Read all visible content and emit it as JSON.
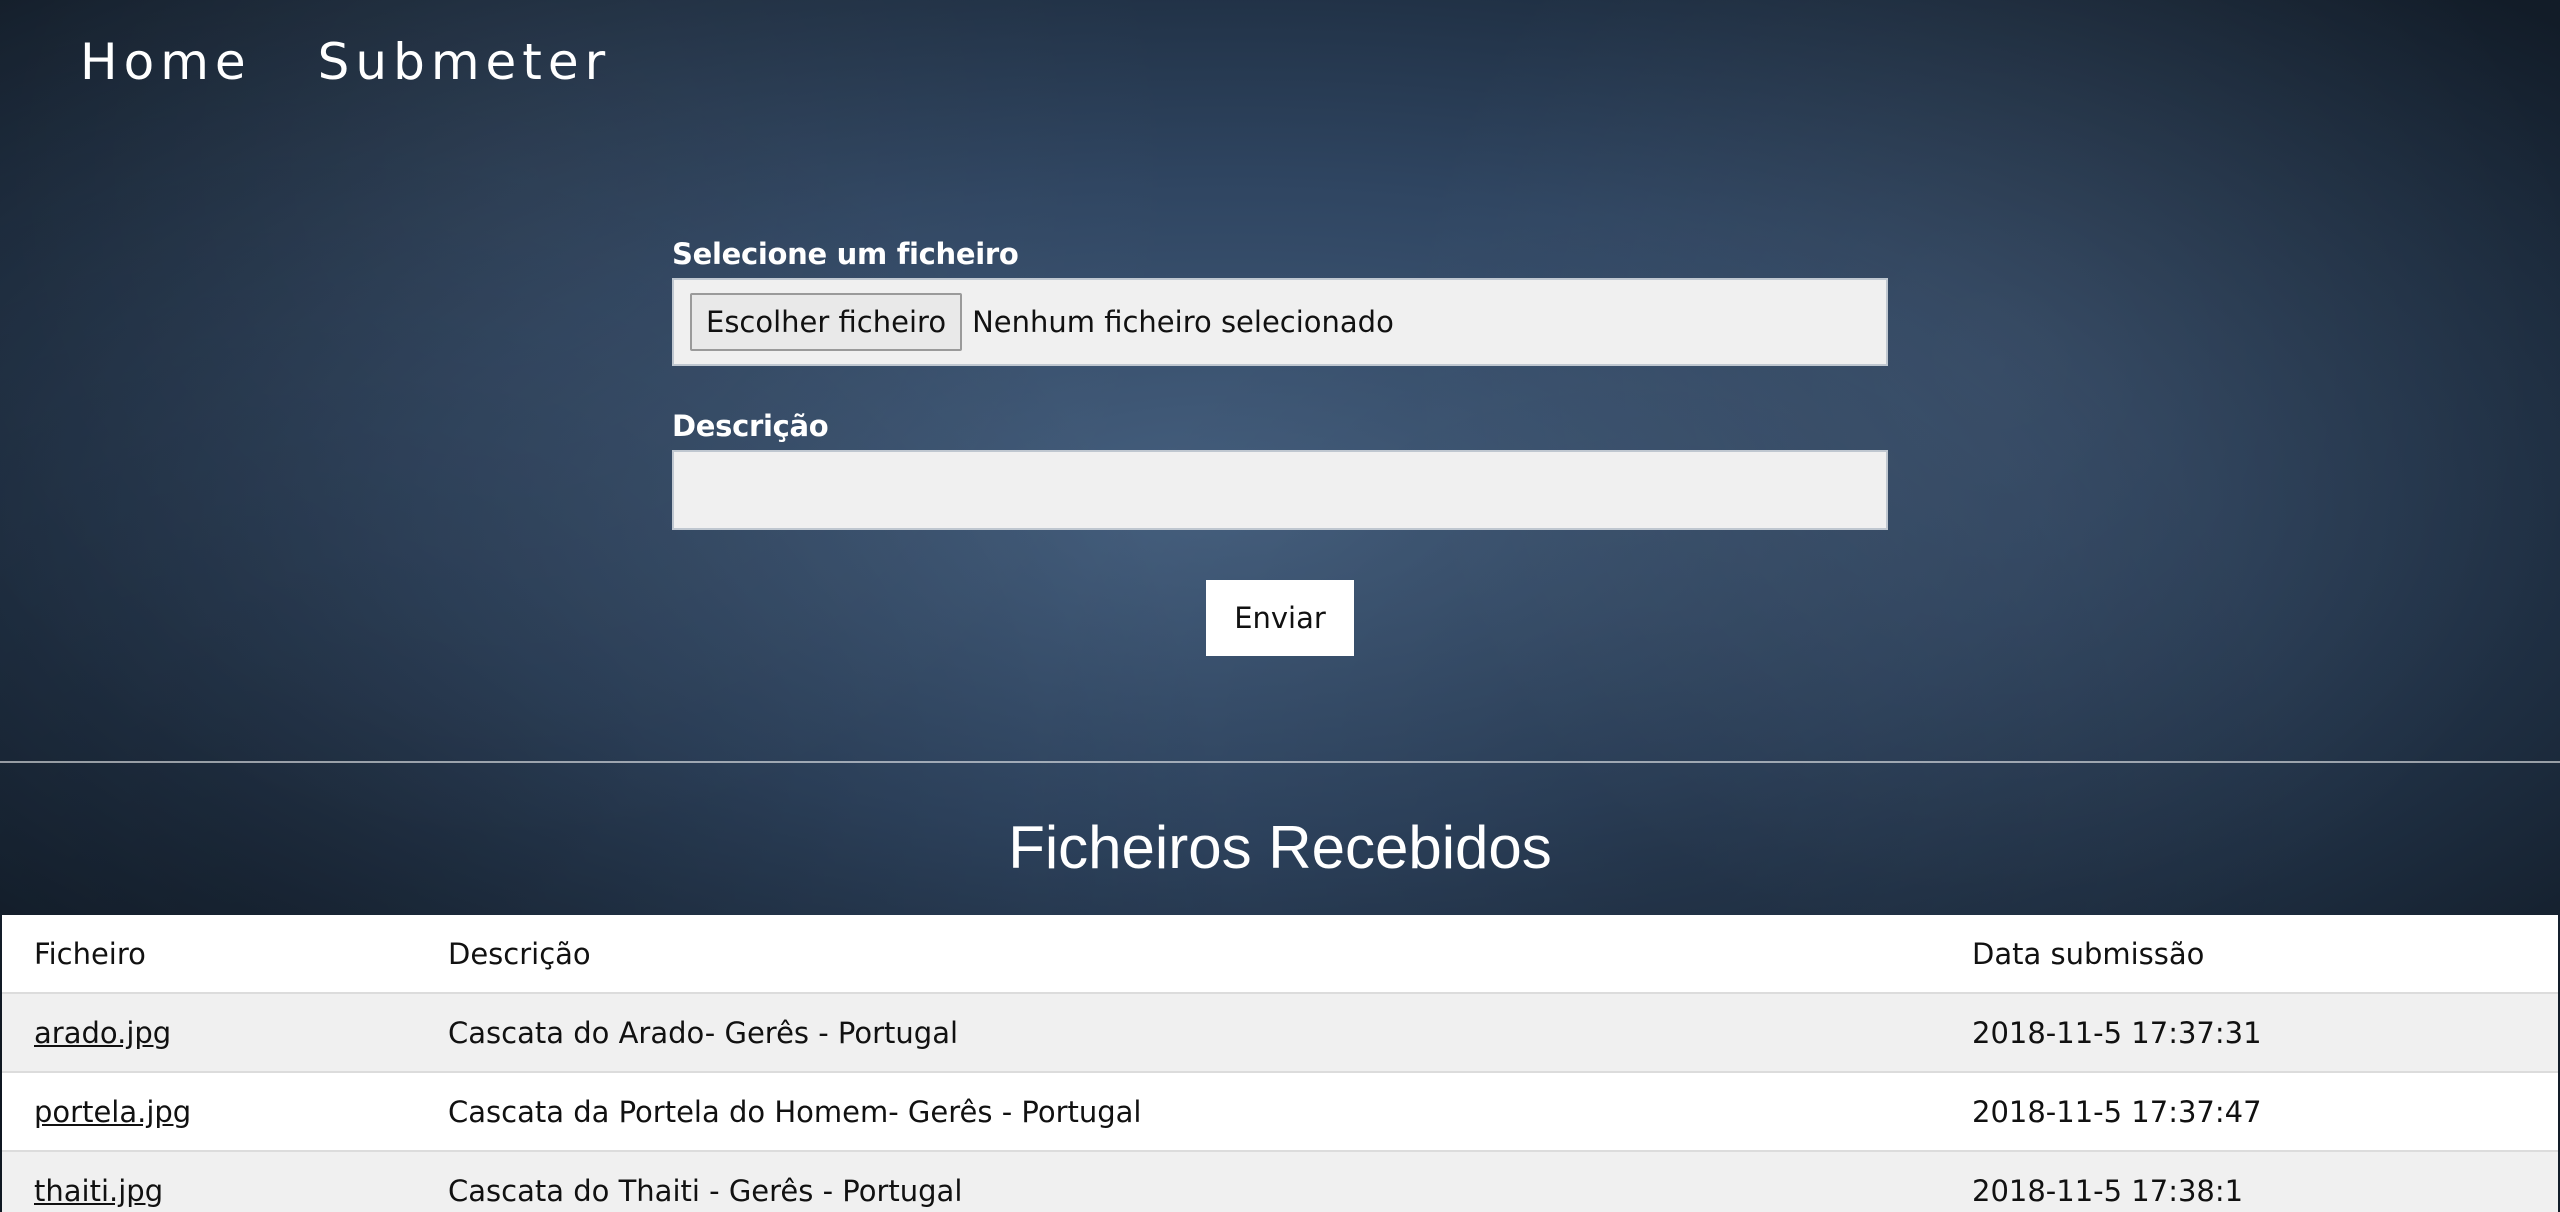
{
  "nav": {
    "items": [
      {
        "label": "Home"
      },
      {
        "label": "Submeter"
      }
    ]
  },
  "form": {
    "file_label": "Selecione um ficheiro",
    "file_button": "Escolher ficheiro",
    "file_status": "Nenhum ficheiro selecionado",
    "description_label": "Descrição",
    "description_value": "",
    "submit_label": "Enviar"
  },
  "received": {
    "title": "Ficheiros Recebidos",
    "columns": [
      "Ficheiro",
      "Descrição",
      "Data submissão"
    ],
    "rows": [
      {
        "file": "arado.jpg",
        "description": "Cascata do Arado- Gerês - Portugal",
        "date": "2018-11-5 17:37:31"
      },
      {
        "file": "portela.jpg",
        "description": "Cascata da Portela do Homem- Gerês - Portugal",
        "date": "2018-11-5 17:37:47"
      },
      {
        "file": "thaiti.jpg",
        "description": "Cascata do Thaiti - Gerês - Portugal",
        "date": "2018-11-5 17:38:1"
      }
    ]
  }
}
